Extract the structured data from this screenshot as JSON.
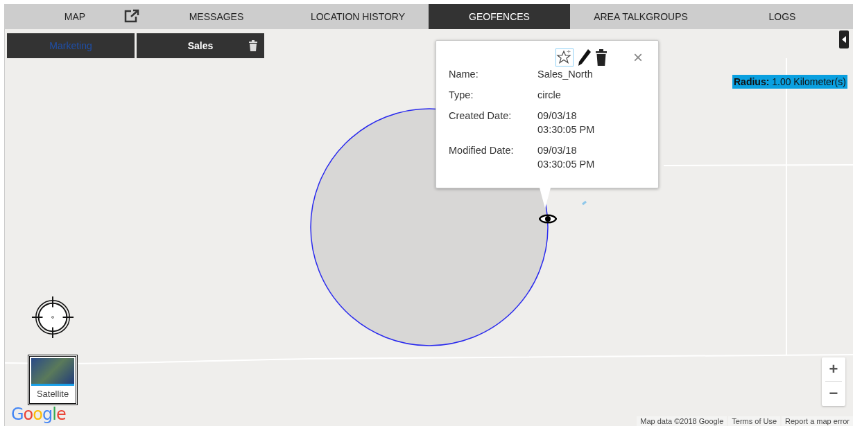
{
  "tabs": [
    {
      "label": "MAP",
      "selected": false,
      "popout": true
    },
    {
      "label": "MESSAGES",
      "selected": false,
      "popout": false
    },
    {
      "label": "LOCATION HISTORY",
      "selected": false,
      "popout": false
    },
    {
      "label": "GEOFENCES",
      "selected": true,
      "popout": false
    },
    {
      "label": "AREA TALKGROUPS",
      "selected": false,
      "popout": false
    },
    {
      "label": "LOGS",
      "selected": false,
      "popout": false
    }
  ],
  "geofence_tabs": [
    {
      "label": "Marketing",
      "selected": false,
      "deletable": false
    },
    {
      "label": "Sales",
      "selected": true,
      "deletable": true
    }
  ],
  "popup": {
    "fields": [
      {
        "label": "Name:",
        "value": "Sales_North"
      },
      {
        "label": "Type:",
        "value": "circle"
      },
      {
        "label": "Created Date:",
        "value": "09/03/18\n03:30:05 PM"
      },
      {
        "label": "Modified Date:",
        "value": "09/03/18\n03:30:05 PM"
      }
    ],
    "close": "×"
  },
  "radius_label": "**Radius:** 1.00 Kilometer(s)",
  "map_type_button": "Satellite",
  "logo": "Google",
  "zoom": {
    "in": "+",
    "out": "−"
  },
  "attribution": [
    "Map data ©2018 Google",
    "Terms of Use",
    "Report a map error"
  ]
}
